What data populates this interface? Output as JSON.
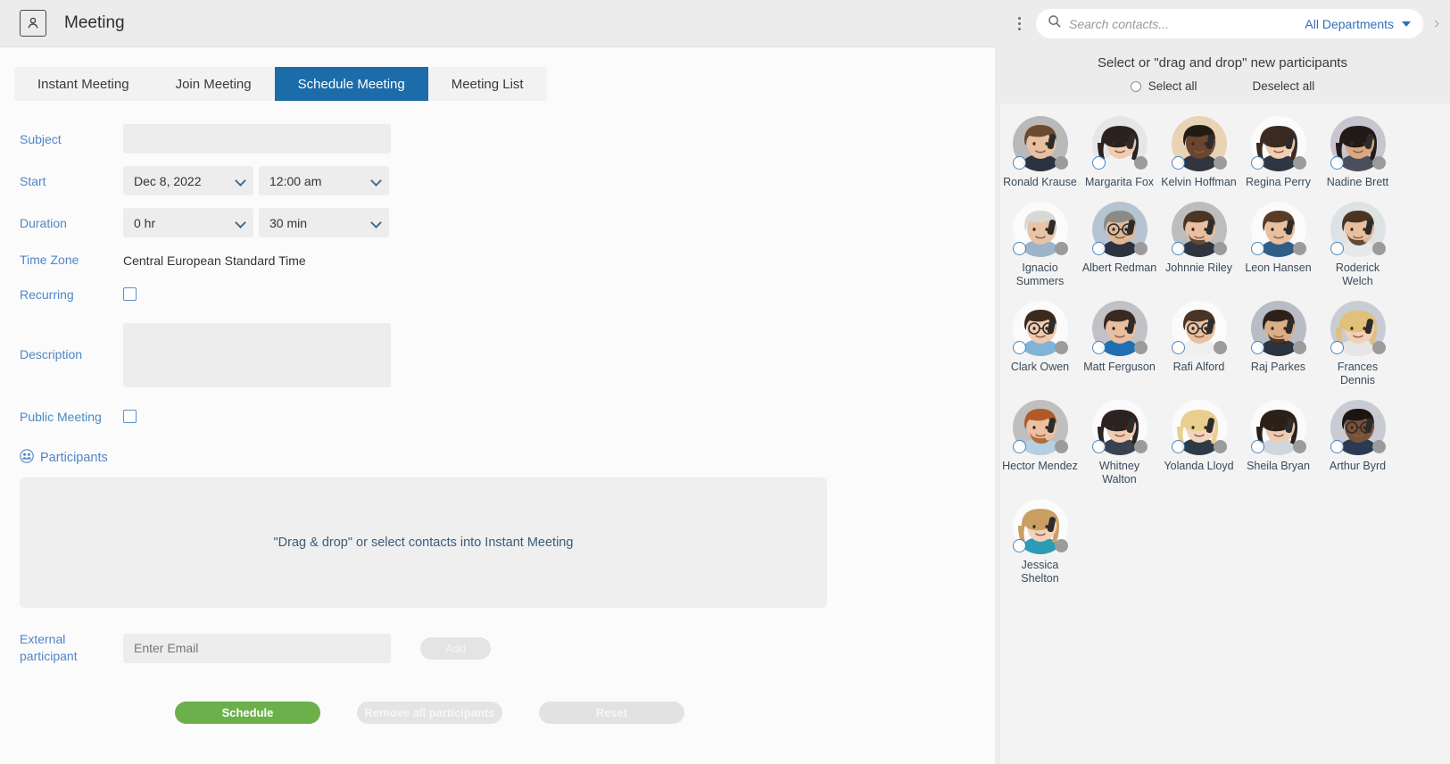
{
  "window": {
    "title": "Meeting",
    "icon": "contact-card-icon"
  },
  "tabs": [
    {
      "label": "Instant Meeting",
      "active": false
    },
    {
      "label": "Join Meeting",
      "active": false
    },
    {
      "label": "Schedule Meeting",
      "active": true
    },
    {
      "label": "Meeting List",
      "active": false
    }
  ],
  "form": {
    "subject": {
      "label": "Subject",
      "value": "",
      "placeholder": ""
    },
    "start": {
      "label": "Start",
      "date_value": "Dec 8, 2022",
      "time_value": "12:00 am"
    },
    "duration": {
      "label": "Duration",
      "hours_value": "0 hr",
      "minutes_value": "30 min"
    },
    "timezone": {
      "label": "Time Zone",
      "value": "Central European Standard Time"
    },
    "recurring": {
      "label": "Recurring",
      "checked": false
    },
    "description": {
      "label": "Description",
      "value": "",
      "placeholder": ""
    },
    "public_meeting": {
      "label": "Public Meeting",
      "checked": false
    },
    "participants": {
      "label": "Participants",
      "dropzone_text": "\"Drag & drop\" or select contacts into Instant Meeting"
    },
    "external": {
      "label": "External participant",
      "placeholder": "Enter Email",
      "value": "",
      "add_label": "Add"
    }
  },
  "actions": {
    "schedule_label": "Schedule",
    "remove_label": "Remove all participants",
    "reset_label": "Reset"
  },
  "colors": {
    "accent_blue": "#1b6ca8",
    "label_blue": "#4f86c6",
    "link_blue": "#2e72b8",
    "schedule_green": "#6cb04b",
    "disabled_gray": "#e4e4e4",
    "status_dot": "#9b9b9b"
  },
  "right_panel": {
    "search": {
      "placeholder": "Search contacts...",
      "value": ""
    },
    "department_filter": "All Departments",
    "panel_title": "Select or \"drag and drop\" new participants",
    "select_all_label": "Select all",
    "deselect_all_label": "Deselect all",
    "contacts": [
      {
        "name": "Ronald Krause",
        "skin": "#e8c0a0",
        "hair": "#6b4a2f",
        "bg": "#b9b9b9",
        "shirt": "#2c3240",
        "glasses": false,
        "beard": false
      },
      {
        "name": "Margarita Fox",
        "skin": "#f0cdb2",
        "hair": "#2b2220",
        "bg": "#e6e6e6",
        "shirt": "#f2f2f2",
        "glasses": false,
        "beard": false,
        "long": true
      },
      {
        "name": "Kelvin Hoffman",
        "skin": "#6a4630",
        "hair": "#241a14",
        "bg": "#e8d3b4",
        "shirt": "#30353f",
        "glasses": false,
        "beard": false
      },
      {
        "name": "Regina Perry",
        "skin": "#f0cdb2",
        "hair": "#3a2a20",
        "bg": "#fbfbfb",
        "shirt": "#2f3643",
        "glasses": false,
        "beard": false,
        "long": true
      },
      {
        "name": "Nadine Brett",
        "skin": "#d8a87e",
        "hair": "#221a16",
        "bg": "#c9c5d0",
        "shirt": "#4a4f5e",
        "glasses": false,
        "beard": false,
        "long": true
      },
      {
        "name": "Ignacio Summers",
        "skin": "#e8c4a6",
        "hair": "#d8d8d4",
        "bg": "#fbfbfb",
        "shirt": "#9db4c8",
        "glasses": false,
        "beard": false
      },
      {
        "name": "Albert Redman",
        "skin": "#e0b894",
        "hair": "#8a8a86",
        "bg": "#b6c4d2",
        "shirt": "#2b3240",
        "glasses": true,
        "beard": false
      },
      {
        "name": "Johnnie Riley",
        "skin": "#e8c0a0",
        "hair": "#4a3526",
        "bg": "#bdbdbd",
        "shirt": "#2e3440",
        "glasses": false,
        "beard": true
      },
      {
        "name": "Leon Hansen",
        "skin": "#e8c0a0",
        "hair": "#5a3c26",
        "bg": "#fbfbfb",
        "shirt": "#2f5d86",
        "glasses": false,
        "beard": false
      },
      {
        "name": "Roderick Welch",
        "skin": "#e8c0a0",
        "hair": "#4c3422",
        "bg": "#dde2e4",
        "shirt": "#e8e8e8",
        "glasses": false,
        "beard": true
      },
      {
        "name": "Clark Owen",
        "skin": "#efcaae",
        "hair": "#3c2a1e",
        "bg": "#fbfbfb",
        "shirt": "#7fb4d6",
        "glasses": true,
        "beard": false
      },
      {
        "name": "Matt Ferguson",
        "skin": "#e8c0a0",
        "hair": "#3a2920",
        "bg": "#c2c2c6",
        "shirt": "#1f6fb2",
        "glasses": false,
        "beard": false
      },
      {
        "name": "Rafi Alford",
        "skin": "#e8c0a0",
        "hair": "#4a3426",
        "bg": "#fbfbfb",
        "shirt": "#efefef",
        "glasses": true,
        "beard": false
      },
      {
        "name": "Raj Parkes",
        "skin": "#dcae86",
        "hair": "#2e2119",
        "bg": "#b8bcc4",
        "shirt": "#2b3240",
        "glasses": false,
        "beard": true
      },
      {
        "name": "Frances Dennis",
        "skin": "#f2d0b6",
        "hair": "#e0c07a",
        "bg": "#c9ccd4",
        "shirt": "#e6e6e6",
        "glasses": false,
        "beard": false,
        "long": true
      },
      {
        "name": "Hector Mendez",
        "skin": "#ecc2a2",
        "hair": "#b05a28",
        "bg": "#bfbfbf",
        "shirt": "#b6cfe2",
        "glasses": false,
        "beard": true
      },
      {
        "name": "Whitney Walton",
        "skin": "#f0cdb2",
        "hair": "#2c2220",
        "bg": "#fbfbfb",
        "shirt": "#3a4250",
        "glasses": false,
        "beard": false,
        "long": true
      },
      {
        "name": "Yolanda Lloyd",
        "skin": "#f4d4ba",
        "hair": "#e8cf8e",
        "bg": "#fbfbfb",
        "shirt": "#2f3a48",
        "glasses": false,
        "beard": false,
        "long": true
      },
      {
        "name": "Sheila Bryan",
        "skin": "#eccdb4",
        "hair": "#2a2018",
        "bg": "#fbfbfb",
        "shirt": "#cfd6de",
        "glasses": false,
        "beard": false,
        "long": true
      },
      {
        "name": "Arthur Byrd",
        "skin": "#7a5238",
        "hair": "#1c1410",
        "bg": "#c8ccd2",
        "shirt": "#2a3a52",
        "glasses": true,
        "beard": false
      },
      {
        "name": "Jessica Shelton",
        "skin": "#f2d2b8",
        "hair": "#c9a062",
        "bg": "#fbfbfb",
        "shirt": "#2d9bb5",
        "glasses": false,
        "beard": false,
        "long": true
      }
    ]
  }
}
